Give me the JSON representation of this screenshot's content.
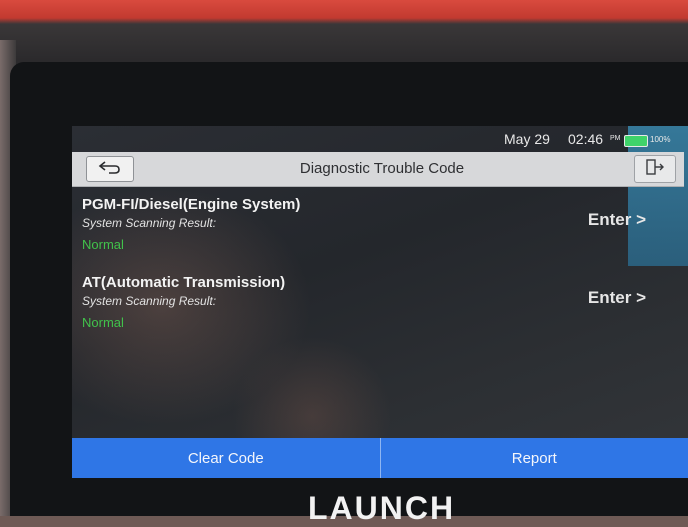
{
  "status_bar": {
    "date": "May 29",
    "time": "02:46",
    "ampm": "PM",
    "battery": "100%"
  },
  "title_bar": {
    "title": "Diagnostic Trouble Code",
    "back_icon": "back-arrow-icon",
    "exit_icon": "exit-icon"
  },
  "systems": [
    {
      "name": "PGM-FI/Diesel(Engine System)",
      "result_label": "System Scanning Result:",
      "status": "Normal",
      "enter_label": "Enter >"
    },
    {
      "name": "AT(Automatic Transmission)",
      "result_label": "System Scanning Result:",
      "status": "Normal",
      "enter_label": "Enter >"
    }
  ],
  "bottom_bar": {
    "clear_code": "Clear Code",
    "report": "Report"
  },
  "brand": "LAUNCH",
  "colors": {
    "accent_blue": "#2f76e6",
    "status_normal": "#41c24b",
    "battery_green": "#3fd36a"
  }
}
